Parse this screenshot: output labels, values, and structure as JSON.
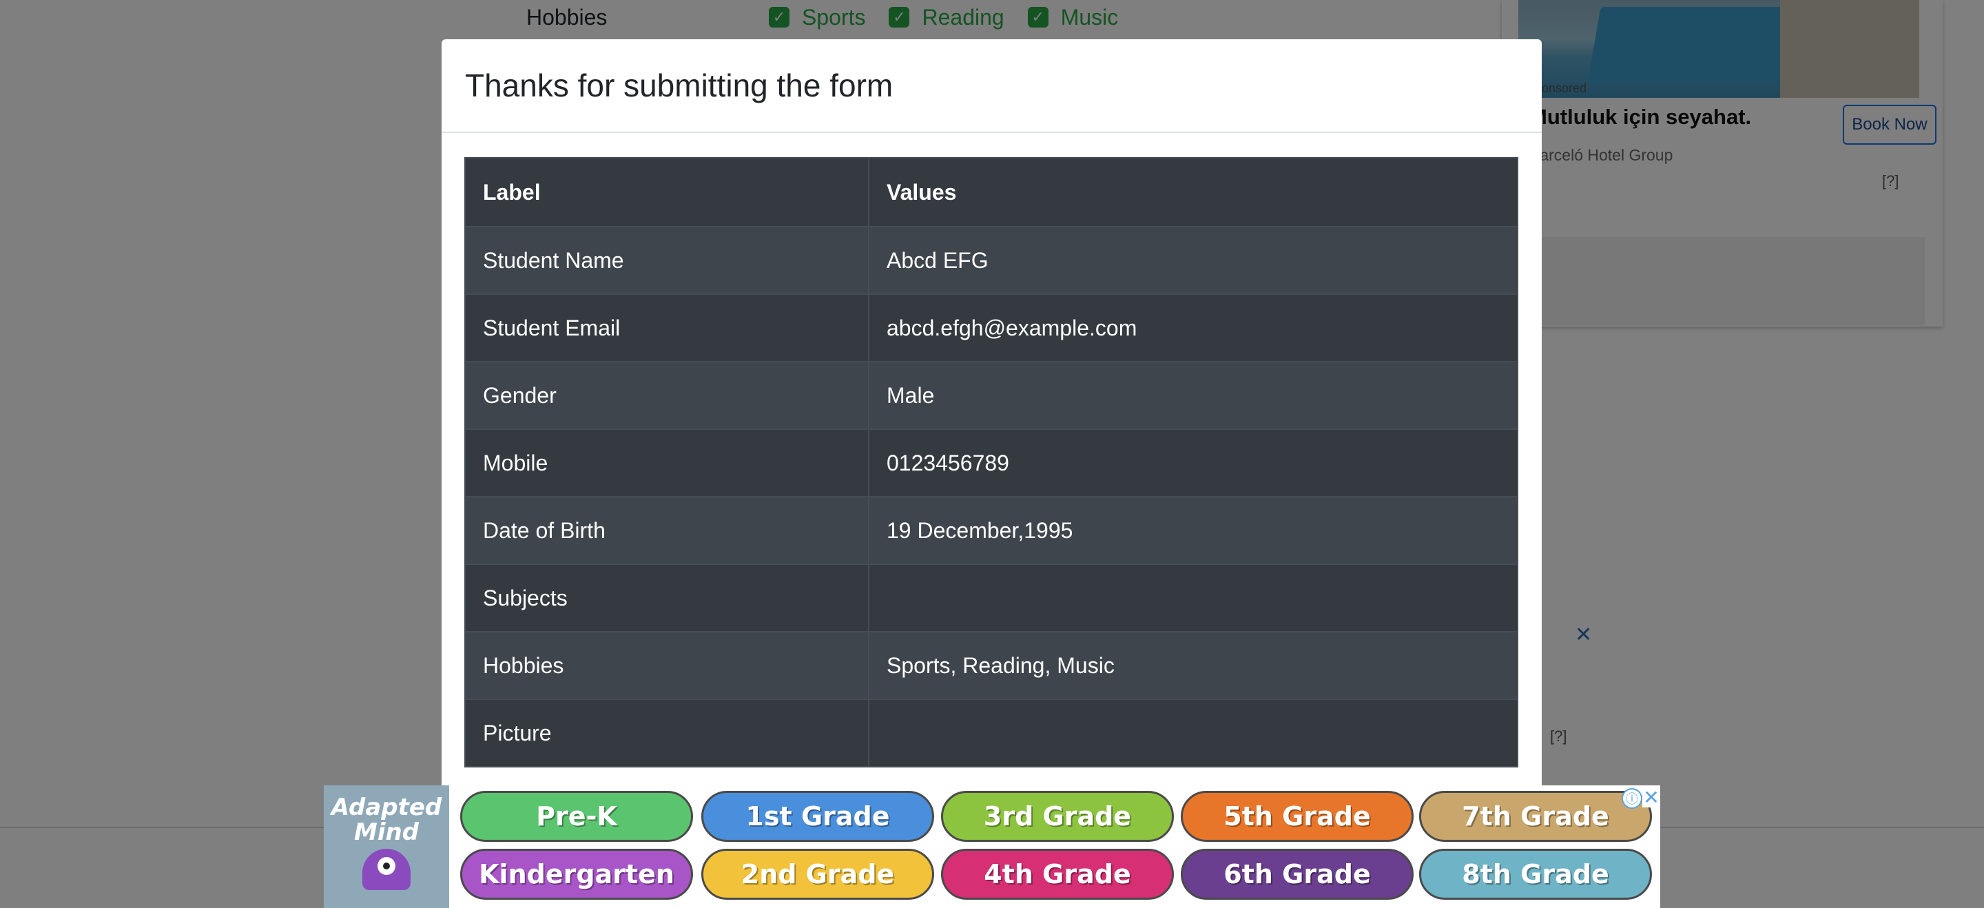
{
  "background": {
    "hobbies_label": "Hobbies",
    "hobbies": [
      "Sports",
      "Reading",
      "Music"
    ],
    "check_color": "#28a745"
  },
  "right_ad": {
    "sponsored": "Sponsored",
    "headline": "Mutluluk için seyahat.",
    "button": "Book Now",
    "company": "Barceló Hotel Group",
    "choice": "[?]",
    "close": "✕",
    "choice2": "[?]"
  },
  "modal": {
    "title": "Thanks for submitting the form",
    "table": {
      "headers": [
        "Label",
        "Values"
      ],
      "rows": [
        {
          "label": "Student Name",
          "value": "Abcd EFG"
        },
        {
          "label": "Student Email",
          "value": "abcd.efgh@example.com"
        },
        {
          "label": "Gender",
          "value": "Male"
        },
        {
          "label": "Mobile",
          "value": "0123456789"
        },
        {
          "label": "Date of Birth",
          "value": "19 December,1995"
        },
        {
          "label": "Subjects",
          "value": ""
        },
        {
          "label": "Hobbies",
          "value": "Sports, Reading, Music"
        },
        {
          "label": "Picture",
          "value": ""
        }
      ]
    }
  },
  "bottom_ad": {
    "logo": "Adapted Mind",
    "info_icon": "ⓘ",
    "close_icon": "✕",
    "grades": [
      {
        "label": "Pre-K",
        "color": "#5bc46f"
      },
      {
        "label": "1st Grade",
        "color": "#4a8fdc"
      },
      {
        "label": "3rd Grade",
        "color": "#8dc43f"
      },
      {
        "label": "5th Grade",
        "color": "#e8762a"
      },
      {
        "label": "7th Grade",
        "color": "#c9a66b"
      },
      {
        "label": "Kindergarten",
        "color": "#a855c8"
      },
      {
        "label": "2nd Grade",
        "color": "#f2c33a"
      },
      {
        "label": "4th Grade",
        "color": "#d62f74"
      },
      {
        "label": "6th Grade",
        "color": "#6b3f8f"
      },
      {
        "label": "8th Grade",
        "color": "#6fb3c6"
      }
    ]
  }
}
